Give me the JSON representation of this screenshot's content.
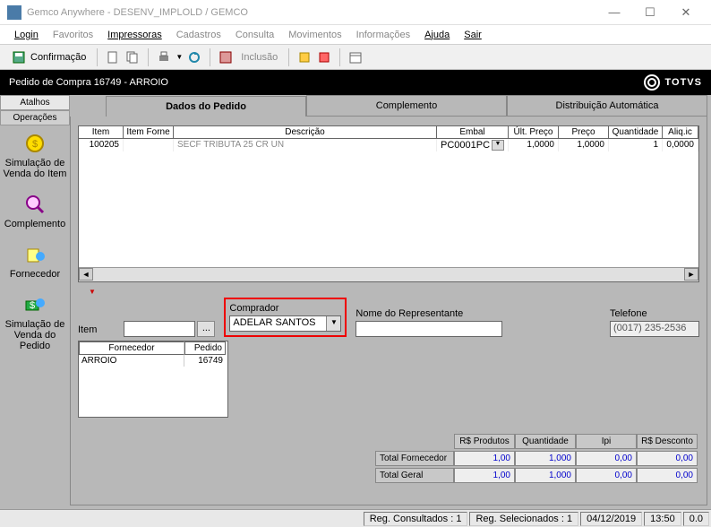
{
  "window": {
    "title": "Gemco Anywhere - DESENV_IMPLOLD / GEMCO"
  },
  "menu": {
    "login": "Login",
    "favoritos": "Favoritos",
    "impressoras": "Impressoras",
    "cadastros": "Cadastros",
    "consulta": "Consulta",
    "movimentos": "Movimentos",
    "informacoes": "Informações",
    "ajuda": "Ajuda",
    "sair": "Sair"
  },
  "toolbar": {
    "confirm": "Confirmação",
    "inclusao": "Inclusão"
  },
  "header": {
    "title": "Pedido de Compra  16749 - ARROIO",
    "brand": "TOTVS"
  },
  "left": {
    "tab_atalhos": "Atalhos",
    "tab_operacoes": "Operações",
    "items": [
      {
        "label": "Simulação de Venda do Item"
      },
      {
        "label": "Complemento"
      },
      {
        "label": "Fornecedor"
      },
      {
        "label": "Simulação de Venda do Pedido"
      }
    ]
  },
  "tabs": {
    "dados": "Dados do Pedido",
    "complemento": "Complemento",
    "dist": "Distribuição Automática"
  },
  "grid": {
    "headers": {
      "item": "Item",
      "forne": "Item Forne",
      "desc": "Descrição",
      "embal": "Embal",
      "ult": "Últ. Preço",
      "preco": "Preço",
      "quant": "Quantidade",
      "aliq": "Aliq.ic"
    },
    "rows": [
      {
        "item": "100205",
        "forne": "",
        "desc": "SECF TRIBUTA 25  CR UN",
        "embal": "PC0001PC",
        "ult": "1,0000",
        "preco": "1,0000",
        "quant": "1",
        "aliq": "0,0000"
      }
    ]
  },
  "form": {
    "item_label": "Item",
    "item_value": "",
    "comprador_label": "Comprador",
    "comprador_value": "ADELAR SANTOS",
    "rep_label": "Nome do Representante",
    "rep_value": "",
    "tel_label": "Telefone",
    "tel_value": "(0017) 235-2536"
  },
  "fp": {
    "h_forn": "Fornecedor",
    "h_ped": "Pedido",
    "rows": [
      {
        "forn": "ARROIO",
        "ped": "16749"
      }
    ]
  },
  "totals": {
    "h_prod": "R$ Produtos",
    "h_quant": "Quantidade",
    "h_ipi": "Ipi",
    "h_desc": "R$ Desconto",
    "rows": [
      {
        "label": "Total Fornecedor",
        "prod": "1,00",
        "quant": "1,000",
        "ipi": "0,00",
        "desc": "0,00"
      },
      {
        "label": "Total Geral",
        "prod": "1,00",
        "quant": "1,000",
        "ipi": "0,00",
        "desc": "0,00"
      }
    ]
  },
  "status": {
    "consult": "Reg. Consultados : 1",
    "selec": "Reg. Selecionados : 1",
    "date": "04/12/2019",
    "time": "13:50",
    "extra": "0.0"
  }
}
